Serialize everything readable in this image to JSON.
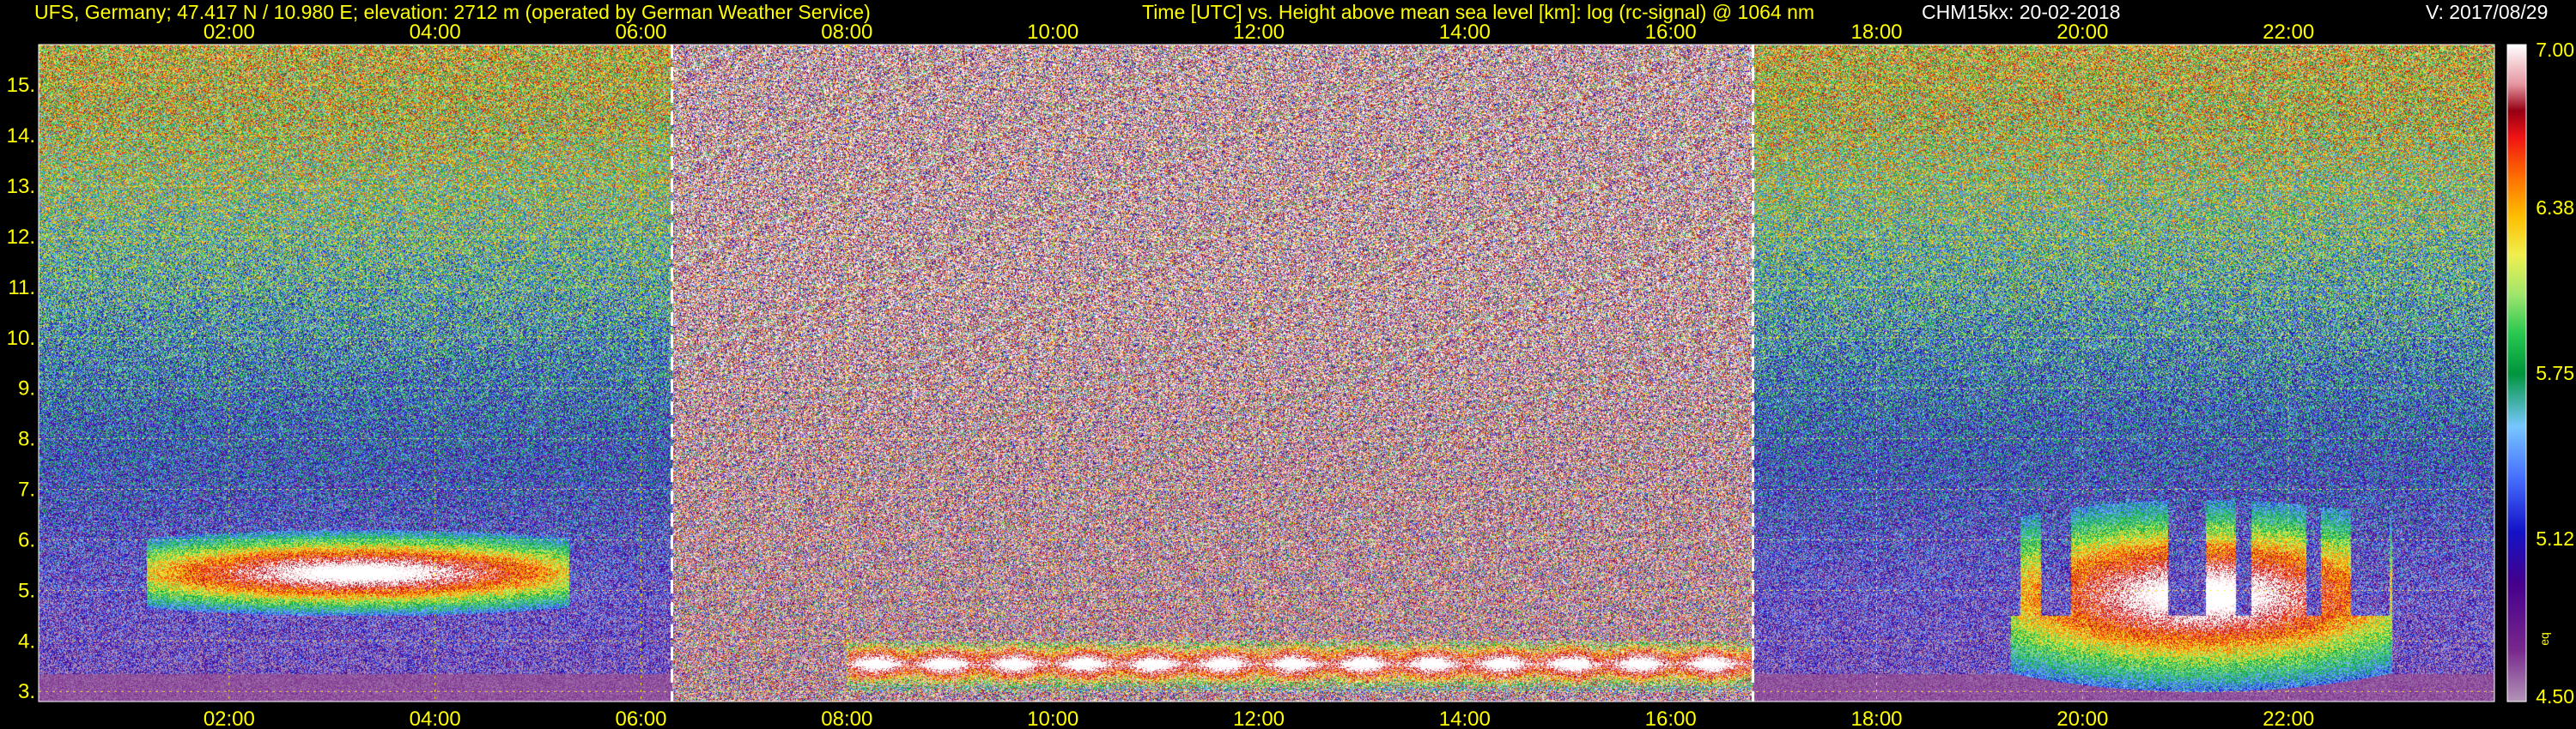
{
  "header": {
    "site": "UFS, Germany; 47.417 N / 10.980 E; elevation: 2712 m  (operated by German Weather Service)",
    "title": "Time [UTC] vs. Height above mean sea level [km]: log (rc-signal) @ 1064 nm",
    "instrument": "CHM15kx: 20-02-2018",
    "version": "V: 2017/08/29"
  },
  "chart_data": {
    "type": "heatmap",
    "title": "Time [UTC] vs. Height above mean sea level [km]: log (rc-signal) @ 1064 nm",
    "xlabel": "Time [UTC]",
    "ylabel": "Height above mean sea level [km]",
    "x_ticks": [
      "02:00",
      "04:00",
      "06:00",
      "08:00",
      "10:00",
      "12:00",
      "14:00",
      "16:00",
      "18:00",
      "20:00",
      "22:00"
    ],
    "x_tick_hours": [
      2,
      4,
      6,
      8,
      10,
      12,
      14,
      16,
      18,
      20,
      22
    ],
    "xlim_hours": [
      0.15,
      24.0
    ],
    "y_ticks": [
      "3.",
      "4.",
      "5.",
      "6.",
      "7.",
      "8.",
      "9.",
      "10.",
      "11.",
      "12.",
      "13.",
      "14.",
      "15."
    ],
    "y_tick_values": [
      3,
      4,
      5,
      6,
      7,
      8,
      9,
      10,
      11,
      12,
      13,
      14,
      15
    ],
    "ylim_km": [
      2.8,
      15.8
    ],
    "grid": true,
    "vertical_markers_hours": [
      6.3,
      16.8
    ],
    "colorbar": {
      "min": 4.5,
      "max": 7.0,
      "tick_labels": [
        "7.00",
        "6.38",
        "5.75",
        "5.12",
        "4.50"
      ],
      "tick_values": [
        7.0,
        6.38,
        5.75,
        5.12,
        4.5
      ],
      "unit": "eq"
    },
    "features": [
      {
        "kind": "cloud",
        "start_hour": 1.2,
        "end_hour": 5.3,
        "bottom_km": 4.5,
        "top_km": 6.2
      },
      {
        "kind": "boundary-layer",
        "start_hour": 8.0,
        "end_hour": 16.8,
        "bottom_km": 3.0,
        "top_km": 4.0
      },
      {
        "kind": "cloud",
        "start_hour": 19.3,
        "end_hour": 23.0,
        "bottom_km": 3.0,
        "top_km": 6.8
      }
    ]
  }
}
